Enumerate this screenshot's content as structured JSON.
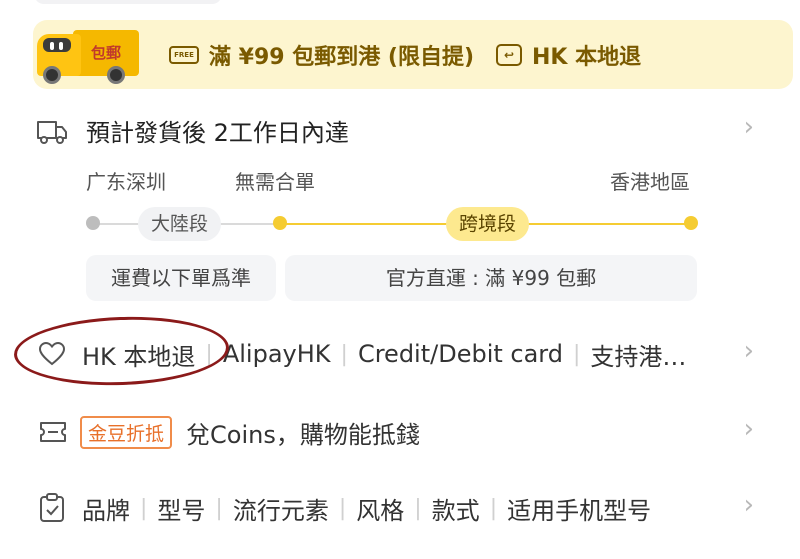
{
  "banner": {
    "truck_label": "包郵",
    "free_icon_text": "FREE",
    "shipping_text": "滿 ¥99 包郵到港 (限自提)",
    "return_text": "HK 本地退"
  },
  "delivery": {
    "estimate": "預計發貨後 2工作日內達",
    "origin": "广东深圳",
    "merge": "無需合單",
    "destination": "香港地區",
    "stage1": "大陸段",
    "stage2": "跨境段",
    "fee_note": "運費以下單爲準",
    "official_note": "官方直運 : 滿 ¥99 包郵",
    "colors": {
      "route_active": "#f5cc32",
      "route_inactive": "#dadada"
    }
  },
  "payments": {
    "items": [
      "HK 本地退",
      "AlipayHK",
      "Credit/Debit card",
      "支持港…"
    ]
  },
  "coins": {
    "badge": "金豆折抵",
    "text": "兌Coins，購物能抵錢"
  },
  "specs": {
    "items": [
      "品牌",
      "型号",
      "流行元素",
      "风格",
      "款式",
      "适用手机型号"
    ]
  },
  "icons": {
    "chevron": "›"
  }
}
